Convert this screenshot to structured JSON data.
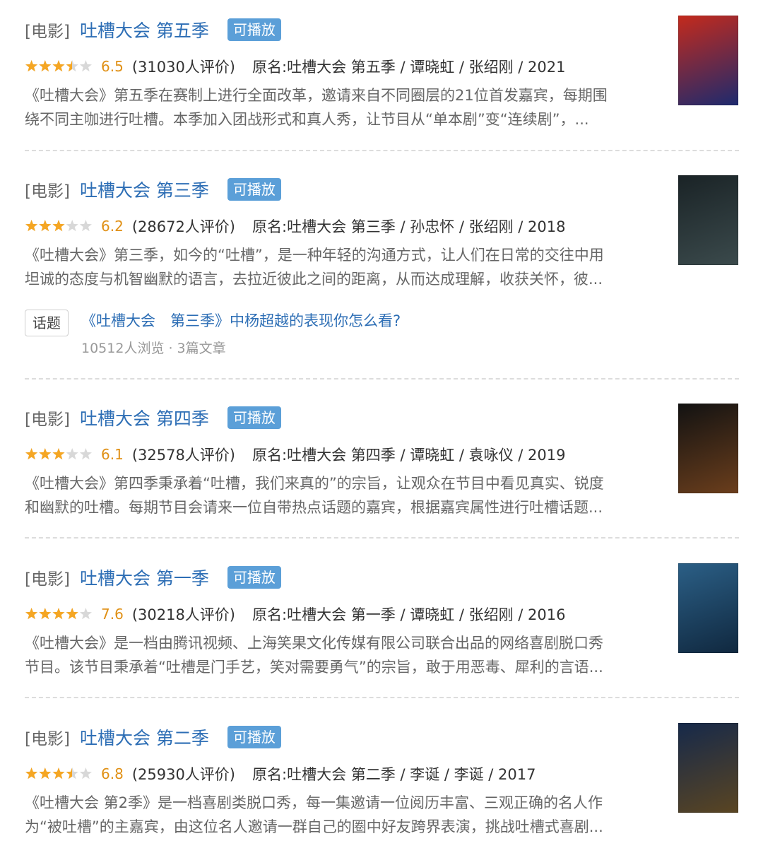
{
  "colors": {
    "link": "#2d6eb5",
    "badge": "#5b9fd8",
    "score": "#e09015",
    "star_filled": "#f5a623",
    "star_empty": "#d8d8d8"
  },
  "results": [
    {
      "type_label": "[电影]",
      "title": "吐槽大会 第五季",
      "badge": "可播放",
      "rating": 3.5,
      "score": "6.5",
      "count": "(31030人评价)",
      "meta": "原名:吐槽大会 第五季 / 谭晓虹 / 张绍刚 / 2021",
      "desc_lines": [
        "《吐槽大会》第五季在赛制上进行全面改革，邀请来自不同圈层的21位首发嘉宾，每期围",
        "绕不同主咖进行吐槽。本季加入团战形式和真人秀，让节目从“单本剧”变“连续剧”，..."
      ],
      "poster_icon": "poster-image",
      "poster_colors": [
        "#c42a1c",
        "#1d2a6e"
      ]
    },
    {
      "type_label": "[电影]",
      "title": "吐槽大会 第三季",
      "badge": "可播放",
      "rating": 3,
      "score": "6.2",
      "count": "(28672人评价)",
      "meta": "原名:吐槽大会 第三季 / 孙忠怀 / 张绍刚 / 2018",
      "desc_lines": [
        "《吐槽大会》第三季，如今的“吐槽”，是一种年轻的沟通方式，让人们在日常的交往中用",
        "坦诚的态度与机智幽默的语言，去拉近彼此之间的距离，从而达成理解，收获关怀，彼..."
      ],
      "poster_icon": "poster-image",
      "poster_colors": [
        "#1a2326",
        "#3b4a4c"
      ]
    },
    {
      "type_label": "[电影]",
      "title": "吐槽大会 第四季",
      "badge": "可播放",
      "rating": 3,
      "score": "6.1",
      "count": "(32578人评价)",
      "meta": "原名:吐槽大会 第四季 / 谭晓虹 / 袁咏仪 / 2019",
      "desc_lines": [
        "《吐槽大会》第四季秉承着“吐槽，我们来真的”的宗旨，让观众在节目中看见真实、锐度",
        "和幽默的吐槽。每期节目会请来一位自带热点话题的嘉宾，根据嘉宾属性进行吐槽话题..."
      ],
      "poster_icon": "poster-image",
      "poster_colors": [
        "#121212",
        "#6b3e1c"
      ]
    },
    {
      "type_label": "[电影]",
      "title": "吐槽大会 第一季",
      "badge": "可播放",
      "rating": 4,
      "score": "7.6",
      "count": "(30218人评价)",
      "meta": "原名:吐槽大会 第一季 / 谭晓虹 / 张绍刚 / 2016",
      "desc_lines": [
        "《吐槽大会》是一档由腾讯视频、上海笑果文化传媒有限公司联合出品的网络喜剧脱口秀",
        "节目。该节目秉承着“吐槽是门手艺，笑对需要勇气”的宗旨，敢于用恶毒、犀利的言语..."
      ],
      "poster_icon": "poster-image",
      "poster_colors": [
        "#2b5f86",
        "#10283f"
      ]
    },
    {
      "type_label": "[电影]",
      "title": "吐槽大会 第二季",
      "badge": "可播放",
      "rating": 3.5,
      "score": "6.8",
      "count": "(25930人评价)",
      "meta": "原名:吐槽大会 第二季 / 李诞 / 李诞 / 2017",
      "desc_lines": [
        "《吐槽大会 第2季》是一档喜剧类脱口秀，每一集邀请一位阅历丰富、三观正确的名人作",
        "为“被吐槽”的主嘉宾，由这位名人邀请一群自己的圈中好友跨界表演，挑战吐槽式喜剧..."
      ],
      "poster_icon": "poster-image",
      "poster_colors": [
        "#16294a",
        "#5a4522"
      ]
    }
  ],
  "topic": {
    "tag": "话题",
    "title": "《吐槽大会　第三季》中杨超越的表现你怎么看?",
    "stats": "10512人浏览 · 3篇文章"
  }
}
